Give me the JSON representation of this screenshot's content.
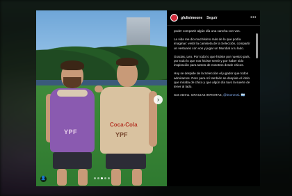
{
  "post": {
    "username": "gfulisimoone",
    "follow_label": "Seguir",
    "more_label": "•••",
    "nav_arrow": "›",
    "caption": {
      "p1": "poder compartir algún día una cancha con vos.",
      "p2": "La vida me dio muchísimo más de lo que podía imaginar: vestir la camiseta de la Selección, compartir un vestuario con vos y jugar un Mundial a tu lado.",
      "p3": "Gracias, Leo. Por todo lo que hiciste por nuestro país, por todo lo que nos hiciste sentir y por haber sido inspiración para tantos de nosotros desde chicos.",
      "p4": "Hoy se despide de la Selección el jugador que todos admiramos. Pero para mí también se despide el ídolo que miraba de chico y que algún día tuvo la suerte de tener al lado.",
      "p5_text": "Sos eterno. GRACIAS INFINITAS, ",
      "p5_mention": "@leomessi",
      "p5_tail": ". 🇦🇷"
    },
    "photo": {
      "bib_text": "YPF",
      "shirt_text_brand": "Coca-Cola",
      "shirt_text_sponsor": "YPF",
      "carousel_count": 5,
      "active_index": 2
    }
  },
  "colors": {
    "avatar": "#d02a3a",
    "mention": "#8ab4f8",
    "bib": "#8a5ab0"
  }
}
